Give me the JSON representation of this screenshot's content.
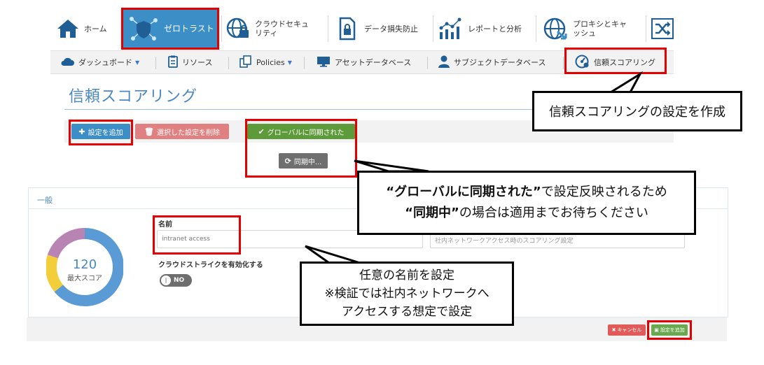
{
  "topnav": {
    "items": [
      {
        "label": "ホーム",
        "icon": "home-icon"
      },
      {
        "label": "ゼロトラスト",
        "icon": "shield-network-icon",
        "active": true
      },
      {
        "label": "クラウドセキュ\nリティ",
        "icon": "globe-lock-icon"
      },
      {
        "label": "データ損失防止",
        "icon": "document-lock-icon"
      },
      {
        "label": "レポートと分析",
        "icon": "analytics-icon"
      },
      {
        "label": "プロキシとキャ\nッシュ",
        "icon": "globe-arrow-icon"
      }
    ]
  },
  "subnav": {
    "dashboard": "ダッシュボード",
    "resources": "リソース",
    "policies": "Policies",
    "asset_db": "アセットデータベース",
    "subject_db": "サブジェクトデータベース",
    "trust_scoring": "信頼スコアリング"
  },
  "page": {
    "title": "信頼スコアリング"
  },
  "toolbar": {
    "add": "設定を追加",
    "delete": "選択した設定を削除",
    "synced": "グローバルに同期された",
    "syncing": "同期中..."
  },
  "panel": {
    "header": "一般",
    "score_value": "120",
    "score_label": "最大スコア",
    "name_label": "名前",
    "name_value": "intranet access",
    "desc_placeholder": "社内ネットワークアクセス時のスコアリング設定",
    "crowdstrike_label": "クラウドストライクを有効化する",
    "toggle_state": "NO"
  },
  "footer": {
    "cancel": "キャンセル",
    "add": "設定を追加"
  },
  "callouts": {
    "create": "信頼スコアリングの設定を作成",
    "sync_line1_bold": "“グローバルに同期された”",
    "sync_line1_rest": "で設定反映されるため",
    "sync_line2_bold": "“同期中”",
    "sync_line2_rest": "の場合は適用までお待ちください",
    "name_line1": "任意の名前を設定",
    "name_line2": "※検証では社内ネットワークへ",
    "name_line3": "アクセスする想定で設定"
  },
  "colors": {
    "primary": "#3c8ec7",
    "danger": "#e08080",
    "success": "#5c9a3a",
    "ring_blue": "#5b9bd5",
    "ring_yellow": "#f2cf3a",
    "ring_purple": "#b884b4",
    "highlight": "#e30000"
  }
}
